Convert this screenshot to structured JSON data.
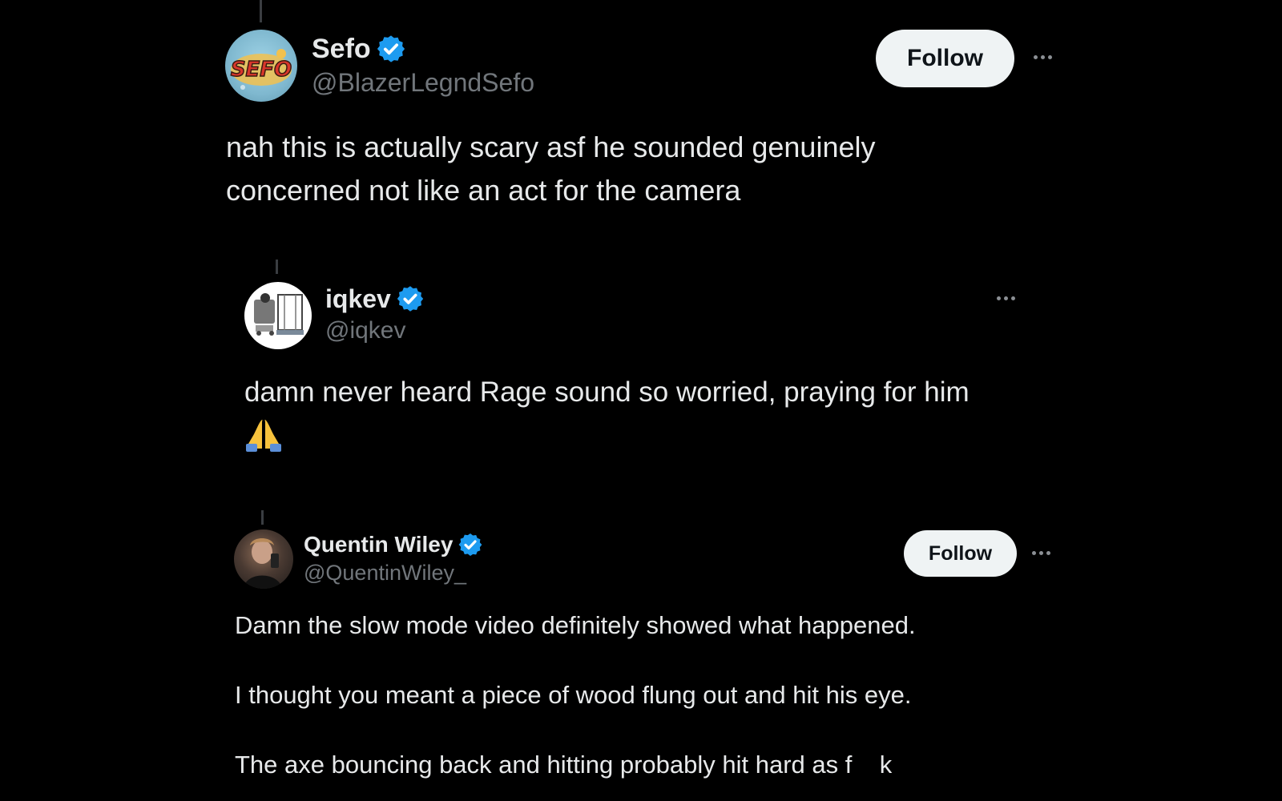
{
  "posts": [
    {
      "name": "Sefo",
      "handle": "@BlazerLegndSefo",
      "avatar_text": "SEFO",
      "verified": true,
      "follow_label": "Follow",
      "lines": [
        "nah this is actually scary asf he sounded genuinely",
        "concerned not like an act for the camera"
      ]
    },
    {
      "name": "iqkev",
      "handle": "@iqkev",
      "verified": true,
      "lines": [
        "damn never heard Rage sound so worried, praying for him"
      ],
      "emoji": "praying-hands"
    },
    {
      "name": "Quentin Wiley",
      "handle": "@QuentinWiley_",
      "verified": true,
      "follow_label": "Follow",
      "paragraphs": [
        "Damn the slow mode video definitely showed what happened.",
        "I thought you meant a piece of wood flung out and hit his eye.",
        "The axe bouncing back and hitting probably hit hard as f    k"
      ]
    }
  ],
  "colors": {
    "background": "#000000",
    "text": "#e7e9ea",
    "muted": "#71767b",
    "verified": "#1d9bf0",
    "follow_bg": "#eff3f4"
  }
}
